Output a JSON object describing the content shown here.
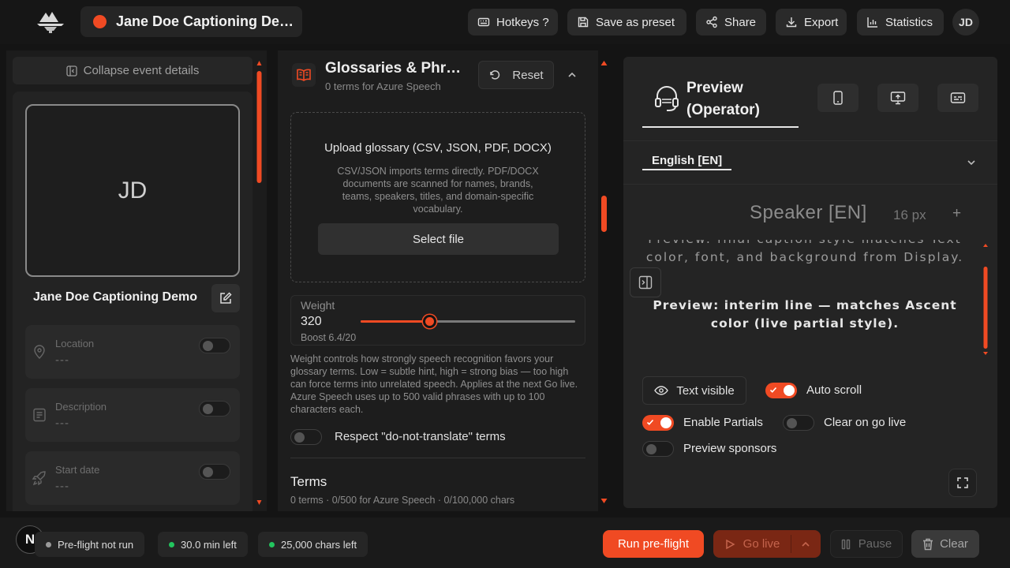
{
  "header": {
    "event_title": "Jane Doe Captioning Demo",
    "buttons": {
      "hotkeys": "Hotkeys ?",
      "save_preset": "Save as preset",
      "share": "Share",
      "export": "Export",
      "statistics": "Statistics"
    },
    "user_initials": "JD",
    "icons": [
      "logo",
      "record-dot-icon",
      "keyboard-icon",
      "save-icon",
      "share-icon",
      "download-icon",
      "bar-chart-icon"
    ]
  },
  "left_panel": {
    "collapse_label": "Collapse event details",
    "avatar_initials": "JD",
    "event_name": "Jane Doe Captioning Demo",
    "fields": [
      {
        "label": "Location",
        "value": "---",
        "enabled": false
      },
      {
        "label": "Description",
        "value": "---",
        "enabled": false
      },
      {
        "label": "Start date",
        "value": "---",
        "enabled": false
      }
    ]
  },
  "glossary": {
    "title": "Glossaries & Phrases",
    "subtitle": "0 terms for Azure Speech",
    "reset_label": "Reset",
    "upload_title": "Upload glossary (CSV, JSON, PDF, DOCX)",
    "upload_description": "CSV/JSON imports terms directly. PDF/DOCX documents are scanned for names, brands, teams, speakers, titles, and domain-specific vocabulary.",
    "select_file_label": "Select file",
    "weight": {
      "label": "Weight",
      "value": "320",
      "boost": "Boost 6.4/20",
      "slider_fraction": 0.32
    },
    "weight_help": "Weight controls how strongly speech recognition favors your glossary terms. Low = subtle hint, high = strong bias — too high can force terms into unrelated speech. Applies at the next Go live. Azure Speech uses up to 500 valid phrases with up to 100 characters each.",
    "respect_dnt_label": "Respect \"do-not-translate\" terms",
    "respect_dnt_enabled": false,
    "terms_title": "Terms",
    "terms_subtitle": "0 terms · 0/500 for Azure Speech · 0/100,000 chars"
  },
  "preview": {
    "tab_label": "Preview (Operator)",
    "language_tab": "English [EN]",
    "speaker_label": "Speaker [EN]",
    "font_size": "16 px",
    "plus_label": "+",
    "final_caption": "Preview: final caption style matches Text color, font, and background from Display.",
    "interim_caption": "Preview: interim line — matches Ascent color (live partial style).",
    "text_visible_label": "Text visible",
    "options": {
      "auto_scroll": {
        "label": "Auto scroll",
        "enabled": true
      },
      "enable_partials": {
        "label": "Enable Partials",
        "enabled": true
      },
      "clear_on_go_live": {
        "label": "Clear on go live",
        "enabled": false
      },
      "preview_sponsors": {
        "label": "Preview sponsors",
        "enabled": false
      }
    },
    "device_icons": [
      "tablet-icon",
      "monitor-icon",
      "captions-icon"
    ]
  },
  "footer": {
    "n_badge": "N",
    "status": [
      {
        "label": "Pre-flight not run",
        "color": "#9a9a9a"
      },
      {
        "label": "30.0 min left",
        "color": "#22c55e"
      },
      {
        "label": "25,000 chars left",
        "color": "#22c55e"
      }
    ],
    "run_preflight_label": "Run pre-flight",
    "go_live_label": "Go live",
    "pause_label": "Pause",
    "clear_label": "Clear"
  },
  "colors": {
    "accent": "#f04a23",
    "background": "#141414",
    "panel": "#1d1d1d",
    "success": "#22c55e"
  }
}
